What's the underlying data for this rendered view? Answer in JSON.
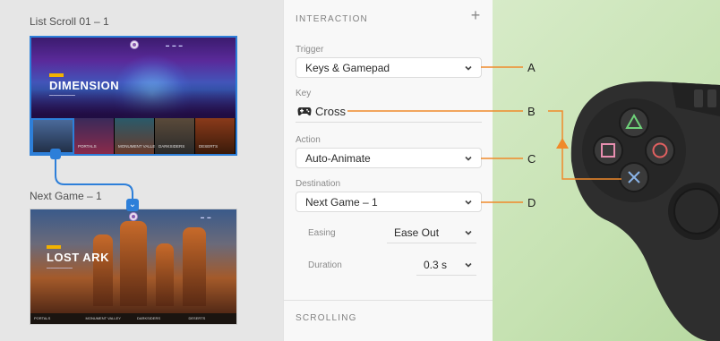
{
  "canvas": {
    "artboard1": {
      "title": "List Scroll 01 – 1",
      "hero_title": "DIMENSION",
      "thumbs": [
        "",
        "PORTALS",
        "MONUMENT VALLEY",
        "DARKSIDERS",
        "DESERTS"
      ]
    },
    "artboard2": {
      "title": "Next Game – 1",
      "hero_title": "LOST ARK",
      "strip": [
        "PORTALS",
        "MONUMENT VALLEY",
        "DARKSIDERS",
        "DESERTS"
      ]
    }
  },
  "panel": {
    "interaction_title": "INTERACTION",
    "add_label": "+",
    "trigger": {
      "label": "Trigger",
      "value": "Keys & Gamepad"
    },
    "key": {
      "label": "Key",
      "value": "Cross"
    },
    "action": {
      "label": "Action",
      "value": "Auto-Animate"
    },
    "destination": {
      "label": "Destination",
      "value": "Next Game – 1"
    },
    "easing": {
      "label": "Easing",
      "value": "Ease Out"
    },
    "duration": {
      "label": "Duration",
      "value": "0.3 s"
    },
    "scrolling_title": "SCROLLING"
  },
  "callouts": [
    "A",
    "B",
    "C",
    "D"
  ],
  "colors": {
    "accent_blue": "#2d7fd9",
    "callout_orange": "#f08a2a",
    "gamepad_body": "#2b2b2b",
    "triangle_green": "#6fd27a",
    "circle_red": "#e06060",
    "square_pink": "#e88fb0",
    "cross_blue": "#8ab4e8"
  },
  "icons": [
    "gamepad-icon",
    "chevron-down-icon",
    "plus-icon",
    "triangle-icon",
    "circle-icon",
    "square-icon",
    "cross-icon",
    "arrow-up-icon"
  ]
}
